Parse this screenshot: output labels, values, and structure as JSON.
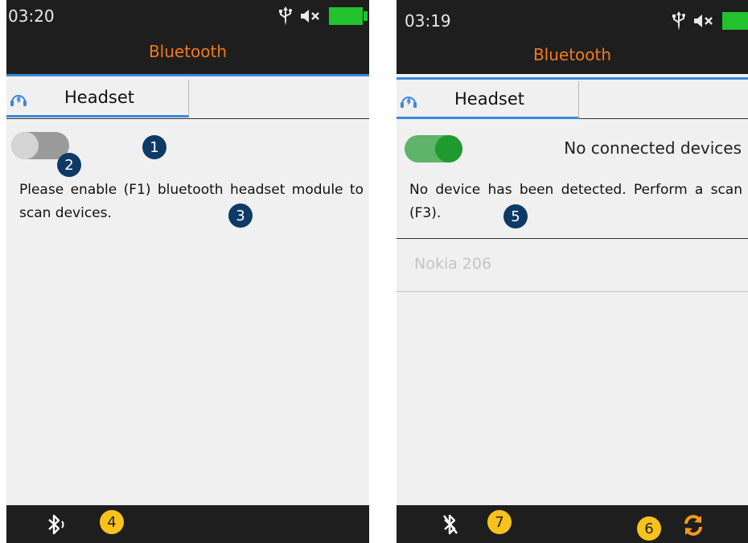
{
  "left": {
    "time": "03:20",
    "title": "Bluetooth",
    "tab_label": "Headset",
    "toggle_on": false,
    "message": "Please enable (F1) bluetooth headset module to scan devices.",
    "bottom_icon": "bluetooth-signal-icon",
    "badges": [
      "1",
      "2",
      "3",
      "4"
    ]
  },
  "right": {
    "time": "03:19",
    "title": "Bluetooth",
    "tab_label": "Headset",
    "toggle_on": true,
    "connection_status": "No connected devices",
    "message": "No device has been detected. Perform a scan (F3).",
    "device": "Nokia 206",
    "bottom_icon": "bluetooth-off-icon",
    "refresh_icon": "refresh-icon",
    "badges": [
      "5",
      "6",
      "7"
    ]
  },
  "colors": {
    "bar": "#1e1e1e",
    "title_orange": "#f07a1e",
    "accent_blue": "#3a8ad8",
    "battery_green": "#22c22e",
    "toggle_on": "#1e9a2e",
    "badge_blue": "#0e3a66",
    "badge_yellow": "#f8c21c"
  }
}
